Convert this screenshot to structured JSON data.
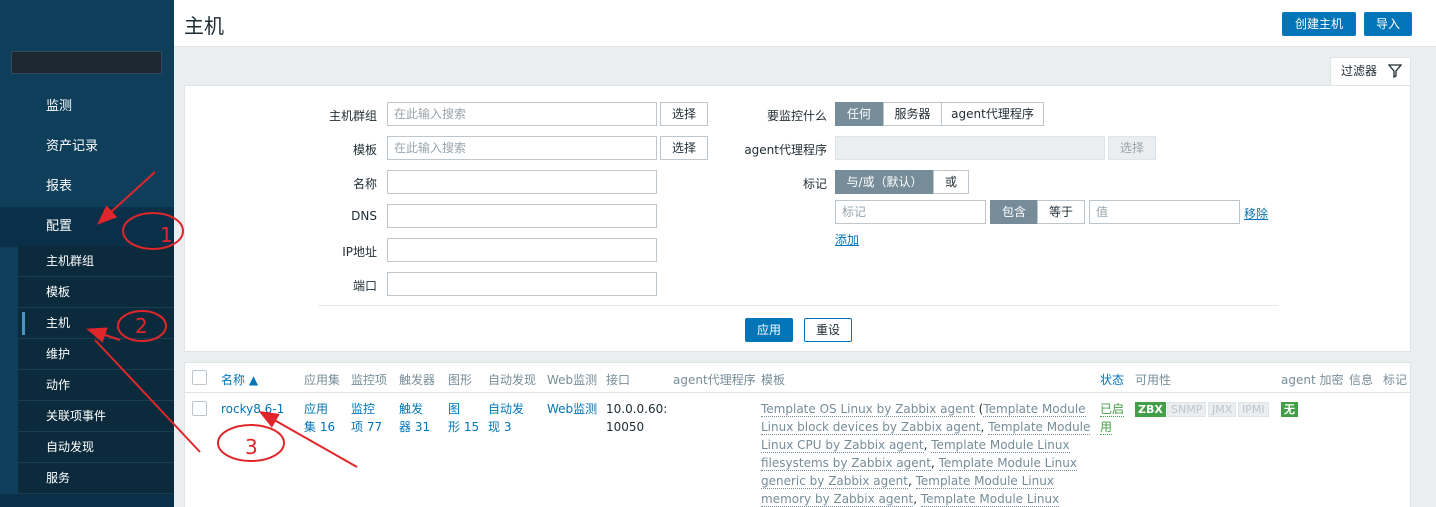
{
  "sidebar": {
    "main_items": [
      {
        "label": "监测"
      },
      {
        "label": "资产记录"
      },
      {
        "label": "报表"
      },
      {
        "label": "配置"
      }
    ],
    "sub_items": [
      {
        "label": "主机群组"
      },
      {
        "label": "模板"
      },
      {
        "label": "主机"
      },
      {
        "label": "维护"
      },
      {
        "label": "动作"
      },
      {
        "label": "关联项事件"
      },
      {
        "label": "自动发现"
      },
      {
        "label": "服务"
      }
    ]
  },
  "header": {
    "title": "主机",
    "create_host_label": "创建主机",
    "import_label": "导入"
  },
  "filter": {
    "tab_label": "过滤器",
    "host_group": {
      "label": "主机群组",
      "placeholder": "在此输入搜索",
      "button": "选择"
    },
    "template": {
      "label": "模板",
      "placeholder": "在此输入搜索",
      "button": "选择"
    },
    "name": {
      "label": "名称",
      "value": ""
    },
    "dns": {
      "label": "DNS",
      "value": ""
    },
    "ip": {
      "label": "IP地址",
      "value": ""
    },
    "port": {
      "label": "端口",
      "value": ""
    },
    "monitored_by": {
      "label": "要监控什么",
      "options": [
        "任何",
        "服务器",
        "agent代理程序"
      ],
      "selected": "任何"
    },
    "proxy": {
      "label": "agent代理程序",
      "button": "选择"
    },
    "tags": {
      "label": "标记",
      "operator_options": [
        "与/或（默认）",
        "或"
      ],
      "tag_placeholder": "标记",
      "match_options": [
        "包含",
        "等于"
      ],
      "value_placeholder": "值",
      "remove_label": "移除",
      "add_label": "添加"
    },
    "apply_label": "应用",
    "reset_label": "重设"
  },
  "table": {
    "headers": {
      "name": "名称 ▲",
      "applications": "应用集",
      "items": "监控项",
      "triggers": "触发器",
      "graphs": "图形",
      "discovery": "自动发现",
      "web": "Web监测",
      "interface": "接口",
      "proxy": "agent代理程序",
      "templates": "模板",
      "status": "状态",
      "availability": "可用性",
      "encryption": "agent 加密",
      "info": "信息",
      "tags": "标记"
    },
    "rows": [
      {
        "name": "rocky8.6-1",
        "apps_1": "应用",
        "apps_2": "集 16",
        "items_1": "监控",
        "items_2": "项 77",
        "triggers_1": "触发",
        "triggers_2": "器 31",
        "graphs_1": "图",
        "graphs_2": "形 15",
        "discovery_1": "自动发",
        "discovery_2": "现 3",
        "web": "Web监测",
        "interface_1": "10.0.0.60:",
        "interface_2": "10050",
        "templates": {
          "t1": "Template OS Linux by Zabbix agent",
          "open": " (",
          "t2": "Template Module Linux block devices by Zabbix agent",
          "sep": ", ",
          "t3": "Template Module Linux CPU by Zabbix agent",
          "t4": "Template Module Linux filesystems by Zabbix agent",
          "t5": "Template Module Linux generic by Zabbix agent",
          "t6": "Template Module Linux memory by Zabbix agent",
          "t7": "Template Module Linux network interfaces by Zabbix agent",
          "comma": ","
        },
        "status_1": "已启",
        "status_2": "用",
        "availability": [
          "ZBX",
          "SNMP",
          "JMX",
          "IPMI"
        ],
        "encryption": "无"
      }
    ]
  },
  "annotations": [
    "1",
    "2",
    "3"
  ],
  "colors": {
    "sidebar_bg": "#0e3e5a",
    "accent_blue": "#0275b8",
    "status_green": "#429e47",
    "annotation_red": "#e0262a"
  }
}
